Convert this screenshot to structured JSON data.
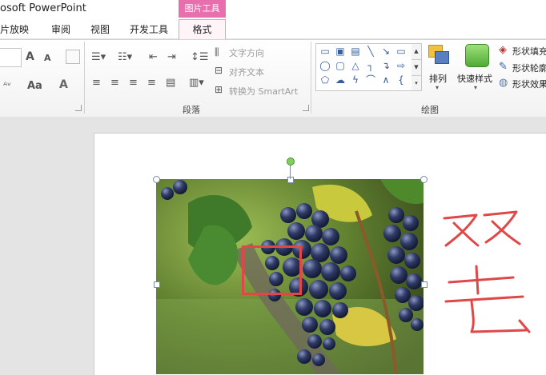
{
  "app": {
    "title": "osoft PowerPoint"
  },
  "context_tab": {
    "header": "图片工具"
  },
  "tabs": [
    {
      "label": "片放映"
    },
    {
      "label": "审阅"
    },
    {
      "label": "视图"
    },
    {
      "label": "开发工具"
    },
    {
      "label": "格式"
    }
  ],
  "ribbon": {
    "font_group": {
      "grow_icon": "A",
      "shrink_icon": "A",
      "font_color_icon": "A",
      "aa_label": "Aa"
    },
    "paragraph": {
      "label": "段落",
      "text_direction": "文字方向",
      "align_text": "对齐文本",
      "convert_smartart": "转换为 SmartArt"
    },
    "drawing": {
      "label": "绘图",
      "arrange": "排列",
      "quick_styles": "快速样式",
      "shape_fill": "形状填充",
      "shape_outline": "形状轮廓",
      "shape_effects": "形状效果"
    }
  },
  "annotation": {
    "text": "双击"
  },
  "colors": {
    "context_accent": "#e86fae",
    "annotation_red": "#e04848",
    "handle_green": "#7ed05a"
  },
  "icons": [
    "grow-font-icon",
    "shrink-font-icon",
    "clear-format-icon",
    "bullets-icon",
    "numbering-icon",
    "decrease-indent-icon",
    "increase-indent-icon",
    "line-spacing-icon",
    "align-left-icon",
    "center-icon",
    "align-right-icon",
    "justify-icon",
    "distribute-icon",
    "columns-icon",
    "shapes-gallery",
    "arrange-icon",
    "quick-styles-icon",
    "shape-fill-icon",
    "shape-outline-icon",
    "shape-effects-icon"
  ]
}
